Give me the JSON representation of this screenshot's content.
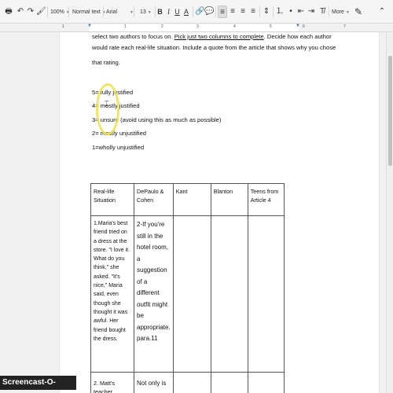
{
  "toolbar": {
    "zoom": "100%",
    "style": "Normal text",
    "font": "Arial",
    "size": "13",
    "bold": "B",
    "italic": "I",
    "underline": "U",
    "text_color": "A",
    "more": "More",
    "icons": {
      "print": "🖶",
      "undo": "↶",
      "redo": "↷",
      "paint": "🖌",
      "link": "🔗",
      "comment": "💬",
      "align_left": "≡",
      "align_center": "≡",
      "align_right": "≡",
      "justify": "≡",
      "line_spacing": "⇕",
      "numbered_list": "⒈",
      "bulleted_list": "•",
      "decrease_indent": "⇤",
      "increase_indent": "⇥",
      "clear_format": "T̸",
      "pen": "✎",
      "collapse": "⌃"
    }
  },
  "ruler": {
    "numbers": [
      "1",
      "1",
      "2",
      "3",
      "4",
      "5",
      "6",
      "7"
    ]
  },
  "document": {
    "line1_a": "select two authors to focus on.  ",
    "line1_link": "Pick just two columns to complete",
    "line1_b": ".  Decide how each author",
    "line2": "would rate each real-life situation.  Include a quote from the article that shows why you chose",
    "line3": "that rating.",
    "scale": [
      "5= fully justified",
      "4= mostly justified",
      "3= unsure (avoid using this as much as possible)",
      "2= mostly unjustified",
      "1=wholly unjustified"
    ]
  },
  "table": {
    "headers": [
      "Real-life Situation",
      "DePaulo & Cohen",
      "Kant",
      "Blanton",
      "Teens from Article 4"
    ],
    "row1": {
      "situation": "1.Maria's best friend tried on a dress at the store.  \"I love it.  What do you think,\" she asked.  \"It's nice,\" Maria said, even though she thought it was awful.  Her friend bought the dress.",
      "depaulo": "2-If you're still in the hotel room, a suggestion of a different outfit might be appropriate. para.11",
      "kant": "",
      "blanton": "",
      "teens": ""
    },
    "row2": {
      "situation": "2. Matt's teacher",
      "depaulo": "Not only is",
      "kant": "",
      "blanton": "",
      "teens": ""
    }
  },
  "watermark": "Screencast-O-Matic.com",
  "colors": {
    "highlight_circle": "#f0e14a",
    "ruler_marker": "#4a6fb5"
  }
}
